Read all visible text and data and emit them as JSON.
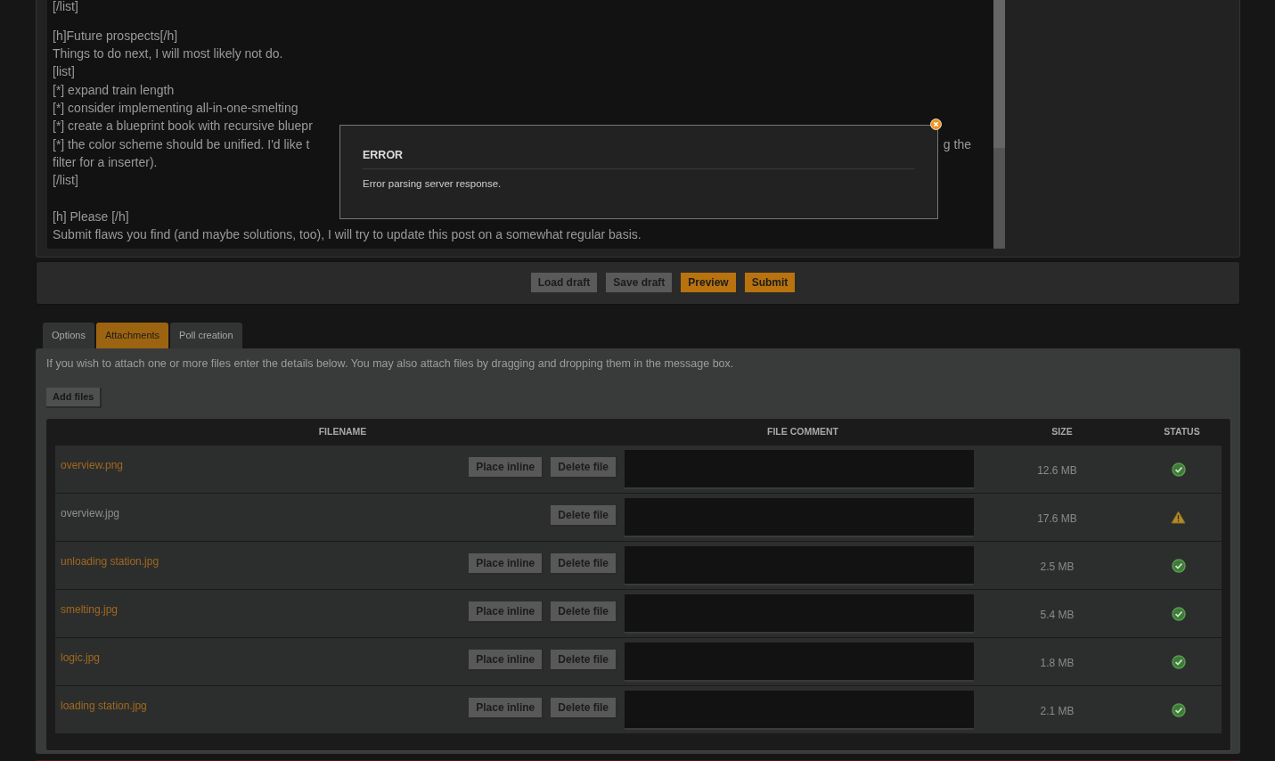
{
  "editor": {
    "lines": [
      {
        "kind": "text",
        "text": "[/list]"
      },
      {
        "kind": "blank"
      },
      {
        "kind": "text",
        "text": "[h]Future prospects[/h]"
      },
      {
        "kind": "text",
        "text": "Things to do next, I will most likely not do."
      },
      {
        "kind": "text",
        "text": "[list]"
      },
      {
        "kind": "text",
        "text": "[*] expand train length"
      },
      {
        "kind": "text",
        "text": "[*] consider implementing all-in-one-smelting"
      },
      {
        "kind": "text",
        "text": "[*] create a blueprint book with recursive bluepr"
      },
      {
        "kind": "text",
        "text": "[*] the color scheme should be unified. I'd like t",
        "tail": "g the"
      },
      {
        "kind": "text",
        "text": "filter for a inserter)."
      },
      {
        "kind": "text",
        "text": "[/list]"
      },
      {
        "kind": "blank"
      },
      {
        "kind": "text",
        "text": "[h] Please [/h]"
      },
      {
        "kind": "text",
        "text": "Submit flaws you find (and maybe solutions, too), I will try to update this post on a somewhat regular basis."
      }
    ]
  },
  "error_dialog": {
    "title": "ERROR",
    "message": "Error parsing server response."
  },
  "actions": [
    {
      "label": "Load draft",
      "primary": false
    },
    {
      "label": "Save draft",
      "primary": false
    },
    {
      "label": "Preview",
      "primary": true
    },
    {
      "label": "Submit",
      "primary": true
    }
  ],
  "tabs": [
    {
      "label": "Options",
      "selected": false
    },
    {
      "label": "Attachments",
      "selected": true
    },
    {
      "label": "Poll creation",
      "selected": false
    }
  ],
  "attachments": {
    "hint": "If you wish to attach one or more files enter the details below. You may also attach files by dragging and dropping them in the message box.",
    "add_button": "Add files",
    "columns": [
      "FILENAME",
      "FILE COMMENT",
      "SIZE",
      "STATUS"
    ],
    "files": [
      {
        "name": "overview.png",
        "place_label": "Place inline",
        "delete_label": "Delete file",
        "size": "12.6 MB",
        "uploaded": true
      },
      {
        "name": "overview.jpg",
        "delete_label": "Delete file",
        "size": "17.6 MB",
        "uploaded": false
      },
      {
        "name": "unloading station.jpg",
        "place_label": "Place inline",
        "delete_label": "Delete file",
        "size": "2.5 MB",
        "uploaded": true
      },
      {
        "name": "smelting.jpg",
        "place_label": "Place inline",
        "delete_label": "Delete file",
        "size": "5.4 MB",
        "uploaded": true
      },
      {
        "name": "logic.jpg",
        "place_label": "Place inline",
        "delete_label": "Delete file",
        "size": "1.8 MB",
        "uploaded": true
      },
      {
        "name": "loading station.jpg",
        "place_label": "Place inline",
        "delete_label": "Delete file",
        "size": "2.1 MB",
        "uploaded": true
      }
    ]
  }
}
